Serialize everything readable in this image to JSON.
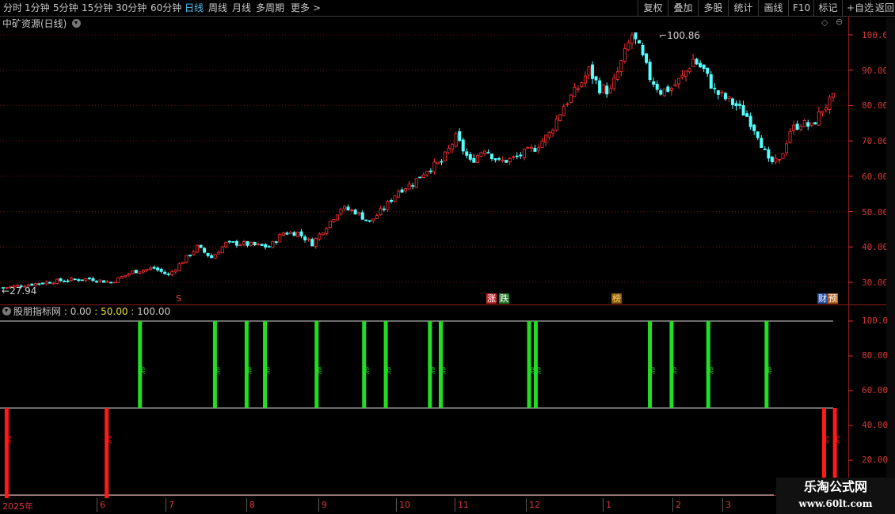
{
  "toolbar": {
    "periods": [
      "分时",
      "1分钟",
      "5分钟",
      "15分钟",
      "30分钟",
      "60分钟",
      "日线",
      "周线",
      "月线",
      "多周期",
      "更多 >"
    ],
    "active_period": "日线",
    "actions": [
      "复权",
      "叠加",
      "多股",
      "统计",
      "画线",
      "F10",
      "标记",
      "+自选",
      "返回"
    ]
  },
  "main_chart": {
    "title": "中矿资源(日线)",
    "high_label": "100.86",
    "low_label": "27.94",
    "y_ticks": [
      "100.0",
      "90.00",
      "80.00",
      "70.00",
      "60.00",
      "50.00",
      "40.00",
      "30.00"
    ],
    "events": [
      {
        "text": "S",
        "color": "#e0403a"
      },
      {
        "text": "涨",
        "color": "#ffffff",
        "bg": "#c0282a"
      },
      {
        "text": "跌",
        "color": "#ffffff",
        "bg": "#2a7a2a"
      },
      {
        "text": "榜",
        "color": "#ffd060",
        "bg": "#8a5a10"
      },
      {
        "text": "财",
        "color": "#ffffff",
        "bg": "#2d4e9e"
      },
      {
        "text": "预",
        "color": "#ffffff",
        "bg": "#b8601a"
      }
    ]
  },
  "indicator": {
    "title": "股朋指标网",
    "v1": ": 0.00",
    "v2": ": 50.00",
    "v3": ": 100.00",
    "y_ticks": [
      "100.0",
      "80.00",
      "60.00",
      "40.00",
      "20.00"
    ],
    "sell_label": "卖",
    "buy_label": "买"
  },
  "x_axis": {
    "labels": [
      "2025年",
      "6",
      "7",
      "8",
      "9",
      "10",
      "11",
      "12",
      "1",
      "2",
      "3"
    ]
  },
  "watermark": {
    "line1": "乐淘公式网",
    "line2": "www.60lt.com"
  },
  "colors": {
    "up": "#ff3030",
    "down": "#54ffff",
    "sell": "#22dd22",
    "buy": "#ff1a1a",
    "axis": "#d8383a"
  },
  "chart_data": {
    "type": "candlestick",
    "y_range": [
      25,
      103
    ],
    "anchors": [
      [
        0,
        28.5
      ],
      [
        8,
        29.5
      ],
      [
        16,
        30.5
      ],
      [
        24,
        31
      ],
      [
        30,
        30
      ],
      [
        36,
        33
      ],
      [
        42,
        34
      ],
      [
        46,
        32
      ],
      [
        50,
        36
      ],
      [
        54,
        40
      ],
      [
        58,
        37
      ],
      [
        62,
        41
      ],
      [
        66,
        41
      ],
      [
        74,
        40
      ],
      [
        78,
        44
      ],
      [
        82,
        44
      ],
      [
        86,
        41
      ],
      [
        90,
        46
      ],
      [
        94,
        51
      ],
      [
        98,
        50
      ],
      [
        102,
        47
      ],
      [
        106,
        51
      ],
      [
        110,
        56
      ],
      [
        114,
        58
      ],
      [
        118,
        62
      ],
      [
        122,
        64
      ],
      [
        126,
        71
      ],
      [
        130,
        64
      ],
      [
        134,
        68
      ],
      [
        138,
        64
      ],
      [
        142,
        65
      ],
      [
        148,
        68
      ],
      [
        152,
        72
      ],
      [
        156,
        80
      ],
      [
        160,
        85
      ],
      [
        163,
        90
      ],
      [
        166,
        85
      ],
      [
        169,
        84
      ],
      [
        172,
        92
      ],
      [
        175,
        100
      ],
      [
        177,
        96
      ],
      [
        180,
        88
      ],
      [
        183,
        84
      ],
      [
        186,
        85
      ],
      [
        189,
        88
      ],
      [
        192,
        93
      ],
      [
        195,
        90
      ],
      [
        198,
        84
      ],
      [
        201,
        82
      ],
      [
        204,
        80
      ],
      [
        207,
        77
      ],
      [
        210,
        72
      ],
      [
        213,
        64
      ],
      [
        216,
        64
      ],
      [
        219,
        73
      ],
      [
        222,
        75
      ],
      [
        225,
        74
      ],
      [
        228,
        79
      ],
      [
        231,
        82
      ]
    ],
    "sell_positions": [
      0.168,
      0.258,
      0.296,
      0.318,
      0.38,
      0.437,
      0.463,
      0.516,
      0.529,
      0.635,
      0.643,
      0.78,
      0.806,
      0.85,
      0.92
    ],
    "buy_positions": [
      0.008,
      0.128,
      0.989,
      1.002
    ]
  }
}
